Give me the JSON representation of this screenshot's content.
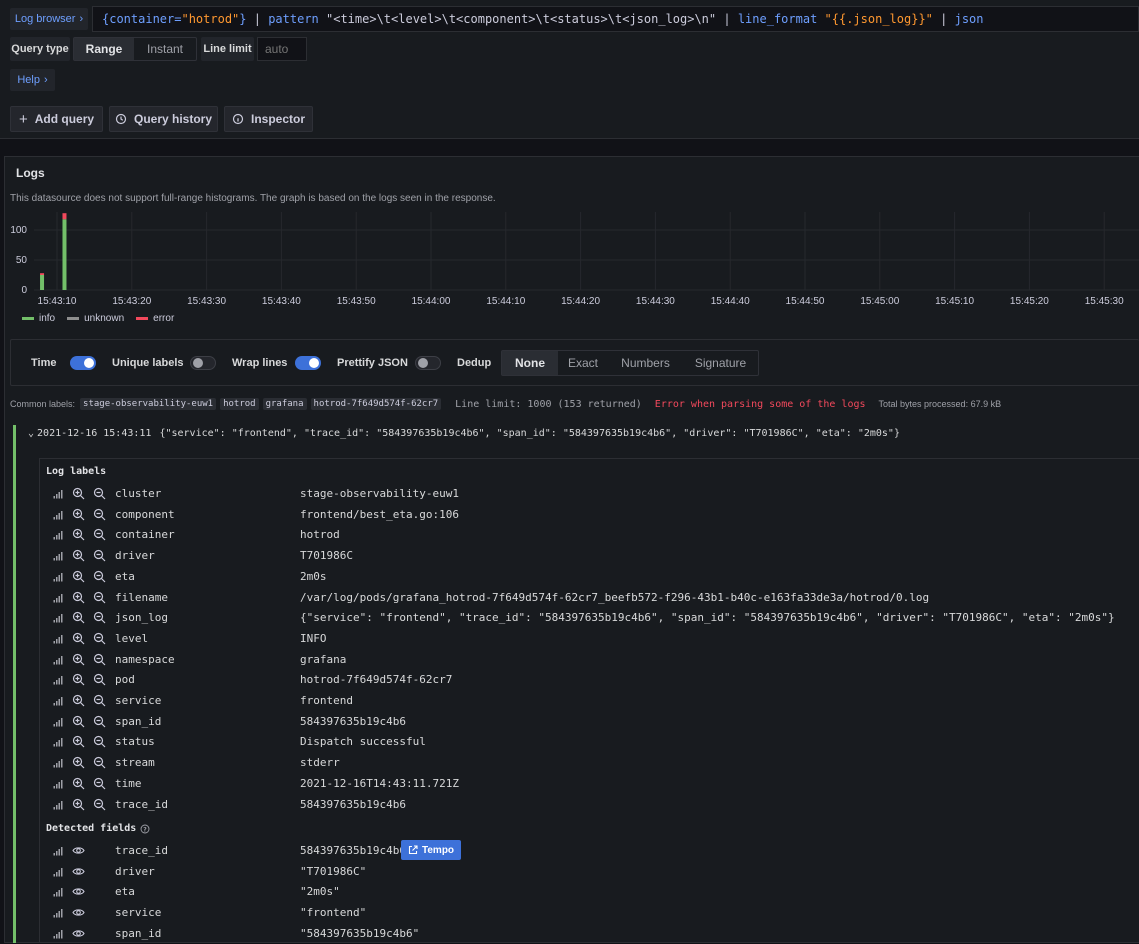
{
  "query": {
    "log_browser_label": "Log browser",
    "expr_open": "{container=",
    "expr_value": "\"hotrod\"",
    "expr_close": "}",
    "pipe1": " | ",
    "pattern_kw": "pattern",
    "pattern_str": " \"<time>\\t<level>\\t<component>\\t<status>\\t<json_log>\\n\"",
    "pipe2": " | ",
    "line_format_kw": "line_format",
    "line_format_str": " \"{{.json_log}}\"",
    "pipe3": " | ",
    "json_kw": "json",
    "query_type_label": "Query type",
    "query_type_options": [
      "Range",
      "Instant"
    ],
    "query_type_selected": "Range",
    "line_limit_label": "Line limit",
    "line_limit_placeholder": "auto",
    "help_label": "Help"
  },
  "toolbar": {
    "add_query": "Add query",
    "query_history": "Query history",
    "inspector": "Inspector"
  },
  "logs": {
    "title": "Logs",
    "histogram_note": "This datasource does not support full-range histograms. The graph is based on the logs seen in the response.",
    "legend": [
      {
        "name": "info",
        "color": "#73bf69"
      },
      {
        "name": "unknown",
        "color": "#8e8e8e"
      },
      {
        "name": "error",
        "color": "#f2495c"
      }
    ]
  },
  "chart_data": {
    "type": "bar",
    "stacked": true,
    "y_ticks": [
      0,
      50,
      100
    ],
    "ylim": [
      0,
      130
    ],
    "x_ticks": [
      "15:43:10",
      "15:43:20",
      "15:43:30",
      "15:43:40",
      "15:43:50",
      "15:44:00",
      "15:44:10",
      "15:44:20",
      "15:44:30",
      "15:44:40",
      "15:44:50",
      "15:45:00",
      "15:45:10",
      "15:45:20",
      "15:45:30"
    ],
    "x": [
      "15:43:08",
      "15:43:11"
    ],
    "series": [
      {
        "name": "info",
        "values": [
          25,
          118
        ]
      },
      {
        "name": "error",
        "values": [
          3,
          10
        ]
      }
    ]
  },
  "options": {
    "time": "Time",
    "unique_labels": "Unique labels",
    "wrap_lines": "Wrap lines",
    "prettify_json": "Prettify JSON",
    "dedup": "Dedup",
    "dedup_options": [
      "None",
      "Exact",
      "Numbers",
      "Signature"
    ],
    "dedup_selected": "None"
  },
  "meta": {
    "common_labels_label": "Common labels:",
    "common_labels": [
      "stage-observability-euw1",
      "hotrod",
      "grafana",
      "hotrod-7f649d574f-62cr7"
    ],
    "line_limit_text": "Line limit: 1000 (153 returned)",
    "error_text": "Error when parsing some of the logs",
    "bytes_text": "Total bytes processed: 67.9 kB"
  },
  "log_line": {
    "timestamp": "2021-12-16 15:43:11",
    "message": "{\"service\": \"frontend\", \"trace_id\": \"584397635b19c4b6\", \"span_id\": \"584397635b19c4b6\", \"driver\": \"T701986C\", \"eta\": \"2m0s\"}"
  },
  "details": {
    "log_labels_title": "Log labels",
    "labels": [
      {
        "key": "cluster",
        "value": "stage-observability-euw1"
      },
      {
        "key": "component",
        "value": "frontend/best_eta.go:106"
      },
      {
        "key": "container",
        "value": "hotrod"
      },
      {
        "key": "driver",
        "value": "T701986C"
      },
      {
        "key": "eta",
        "value": "2m0s"
      },
      {
        "key": "filename",
        "value": "/var/log/pods/grafana_hotrod-7f649d574f-62cr7_beefb572-f296-43b1-b40c-e163fa33de3a/hotrod/0.log"
      },
      {
        "key": "json_log",
        "value": "{\"service\": \"frontend\", \"trace_id\": \"584397635b19c4b6\", \"span_id\": \"584397635b19c4b6\", \"driver\": \"T701986C\", \"eta\": \"2m0s\"}"
      },
      {
        "key": "level",
        "value": "INFO"
      },
      {
        "key": "namespace",
        "value": "grafana"
      },
      {
        "key": "pod",
        "value": "hotrod-7f649d574f-62cr7"
      },
      {
        "key": "service",
        "value": "frontend"
      },
      {
        "key": "span_id",
        "value": "584397635b19c4b6"
      },
      {
        "key": "status",
        "value": "Dispatch successful"
      },
      {
        "key": "stream",
        "value": "stderr"
      },
      {
        "key": "time",
        "value": "2021-12-16T14:43:11.721Z"
      },
      {
        "key": "trace_id",
        "value": "584397635b19c4b6"
      }
    ],
    "detected_fields_title": "Detected fields",
    "fields": [
      {
        "key": "trace_id",
        "value": "584397635b19c4b6",
        "link": "Tempo"
      },
      {
        "key": "driver",
        "value": "\"T701986C\""
      },
      {
        "key": "eta",
        "value": "\"2m0s\""
      },
      {
        "key": "service",
        "value": "\"frontend\""
      },
      {
        "key": "span_id",
        "value": "\"584397635b19c4b6\""
      }
    ]
  },
  "colors": {
    "accent": "#3d71d9",
    "link_blue": "#6e9fff",
    "string_orange": "#ff9830",
    "error_red": "#f2495c",
    "info_green": "#73bf69"
  }
}
